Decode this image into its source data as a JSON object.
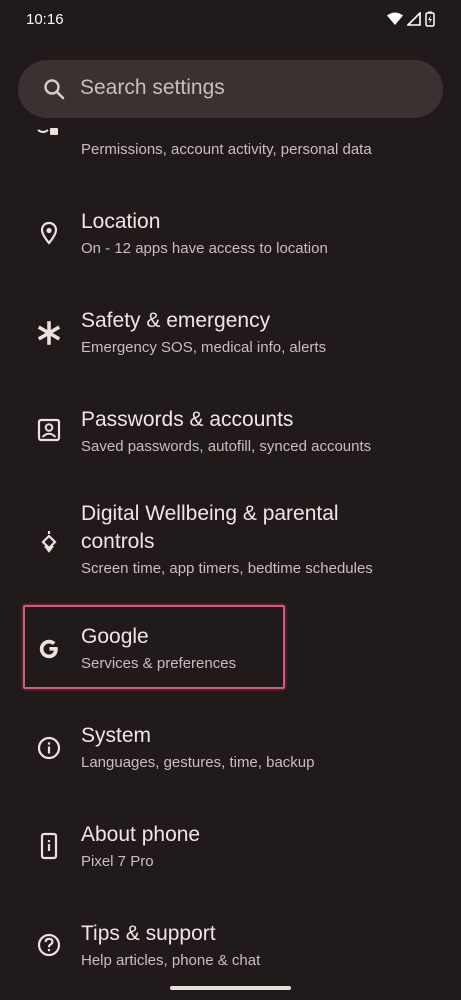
{
  "status_bar": {
    "time": "10:16"
  },
  "search": {
    "placeholder": "Search settings"
  },
  "items": [
    {
      "title": "",
      "subtitle": "Permissions, account activity, personal data",
      "icon": "privacy-icon"
    },
    {
      "title": "Location",
      "subtitle": "On - 12 apps have access to location",
      "icon": "location-pin-icon"
    },
    {
      "title": "Safety & emergency",
      "subtitle": "Emergency SOS, medical info, alerts",
      "icon": "asterisk-icon"
    },
    {
      "title": "Passwords & accounts",
      "subtitle": "Saved passwords, autofill, synced accounts",
      "icon": "account-box-icon"
    },
    {
      "title": "Digital Wellbeing & parental controls",
      "subtitle": "Screen time, app timers, bedtime schedules",
      "icon": "wellbeing-icon"
    },
    {
      "title": "Google",
      "subtitle": "Services & preferences",
      "icon": "google-icon"
    },
    {
      "title": "System",
      "subtitle": "Languages, gestures, time, backup",
      "icon": "info-icon"
    },
    {
      "title": "About phone",
      "subtitle": "Pixel 7 Pro",
      "icon": "phone-info-icon"
    },
    {
      "title": "Tips & support",
      "subtitle": "Help articles, phone & chat",
      "icon": "help-icon"
    }
  ],
  "colors": {
    "background": "#201a1a",
    "search_bg": "#3a3130",
    "highlight": "#d9557a"
  }
}
